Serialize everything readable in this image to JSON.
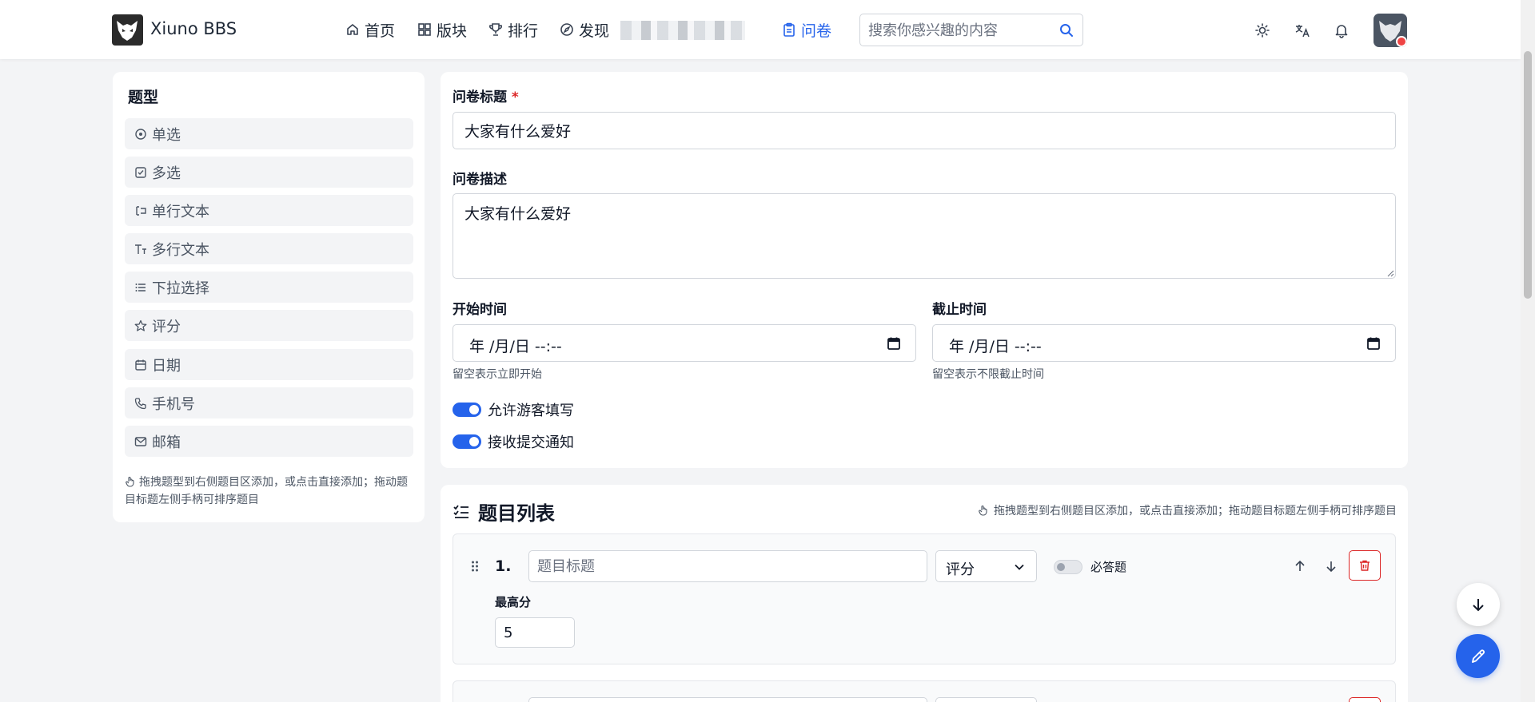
{
  "header": {
    "brand": "Xiuno BBS",
    "nav": [
      {
        "label": "首页",
        "icon": "home-icon"
      },
      {
        "label": "版块",
        "icon": "grid-icon"
      },
      {
        "label": "排行",
        "icon": "trophy-icon"
      },
      {
        "label": "发现",
        "icon": "compass-icon"
      }
    ],
    "nav_active": {
      "label": "问卷",
      "icon": "clipboard-icon"
    },
    "search": {
      "placeholder": "搜索你感兴趣的内容",
      "value": ""
    },
    "icons": [
      "sun-icon",
      "translate-icon",
      "bell-icon"
    ],
    "accent_color": "#2563eb"
  },
  "sidebar": {
    "title": "题型",
    "items": [
      {
        "label": "单选",
        "icon": "radio-icon"
      },
      {
        "label": "多选",
        "icon": "checkbox-icon"
      },
      {
        "label": "单行文本",
        "icon": "text-cursor-icon"
      },
      {
        "label": "多行文本",
        "icon": "text-size-icon"
      },
      {
        "label": "下拉选择",
        "icon": "list-icon"
      },
      {
        "label": "评分",
        "icon": "star-icon"
      },
      {
        "label": "日期",
        "icon": "calendar-icon"
      },
      {
        "label": "手机号",
        "icon": "phone-icon"
      },
      {
        "label": "邮箱",
        "icon": "mail-icon"
      }
    ],
    "hint": "拖拽题型到右侧题目区添加，或点击直接添加；拖动题目标题左侧手柄可排序题目"
  },
  "form": {
    "title_label": "问卷标题",
    "required_mark": "*",
    "title_value": "大家有什么爱好",
    "desc_label": "问卷描述",
    "desc_value": "大家有什么爱好",
    "start_label": "开始时间",
    "start_value": "年 /月/日 --:--",
    "start_help": "留空表示立即开始",
    "end_label": "截止时间",
    "end_value": "年 /月/日 --:--",
    "end_help": "留空表示不限截止时间",
    "toggle_guest": "允许游客填写",
    "toggle_notify": "接收提交通知"
  },
  "questions": {
    "title": "题目列表",
    "hint": "拖拽题型到右侧题目区添加，或点击直接添加；拖动题目标题左侧手柄可排序题目",
    "items": [
      {
        "number": "1.",
        "title_placeholder": "题目标题",
        "title_value": "",
        "type": "评分",
        "required_label": "必答题",
        "max_label": "最高分",
        "max_value": "5"
      }
    ]
  },
  "colors": {
    "danger": "#dc2626",
    "page_bg": "#f3f4f6"
  }
}
